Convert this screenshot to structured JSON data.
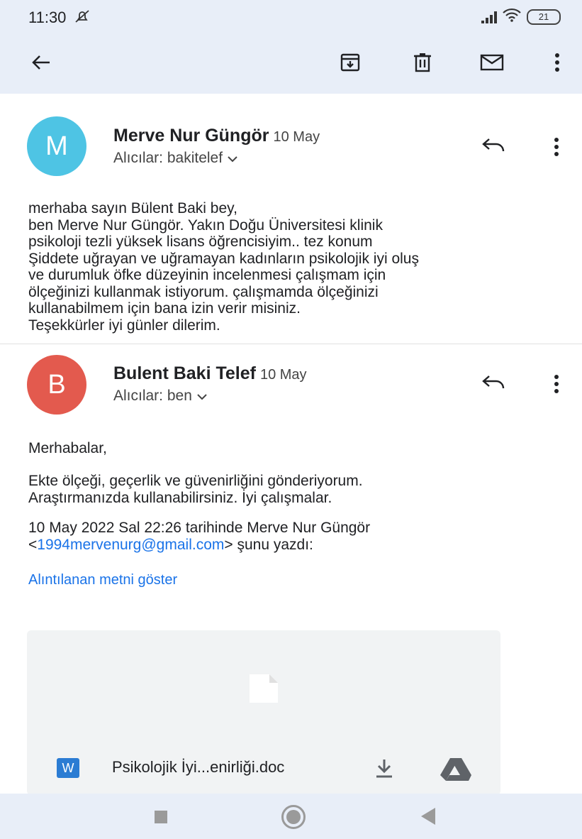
{
  "status_bar": {
    "time": "11:30",
    "battery": "21"
  },
  "message1": {
    "avatar_letter": "M",
    "avatar_color": "#4ec4e4",
    "sender": "Merve Nur Güngör",
    "date": "10 May",
    "recipients": "Alıcılar: bakitelef",
    "body_lines": [
      "merhaba sayın Bülent Baki bey,",
      "ben Merve Nur Güngör. Yakın Doğu Üniversitesi klinik",
      "psikoloji tezli yüksek lisans öğrencisiyim.. tez konum",
      "Şiddete uğrayan ve uğramayan kadınların psikolojik iyi oluş",
      "ve durumluk öfke düzeyinin incelenmesi çalışmam için",
      "ölçeğinizi kullanmak istiyorum. çalışmamda ölçeğinizi",
      "kullanabilmem için bana izin verir misiniz.",
      "Teşekkürler iyi günler dilerim."
    ]
  },
  "message2": {
    "avatar_letter": "B",
    "avatar_color": "#e35a4e",
    "sender": "Bulent Baki Telef",
    "date": "10 May",
    "recipients": "Alıcılar: ben",
    "greeting": "Merhabalar,",
    "body_lines": [
      "Ekte ölçeği, geçerlik ve güvenirliğini gönderiyorum.",
      "Araştırmanızda kullanabilirsiniz. İyi çalışmalar."
    ],
    "quote_header": "10 May 2022 Sal 22:26 tarihinde Merve Nur Güngör",
    "quote_email_prefix": "<",
    "quote_email": "1994mervenurg@gmail.com",
    "quote_email_suffix": "> şunu yazdı:",
    "show_quoted": "Alıntılanan metni göster"
  },
  "attachment": {
    "type_badge": "W",
    "filename": "Psikolojik İyi...enirliği.doc"
  },
  "icons": {
    "back": "arrow-left-icon",
    "archive": "archive-icon",
    "delete": "trash-icon",
    "unread": "mail-icon",
    "more": "more-vert-icon"
  },
  "colors": {
    "accent": "#1a73e8",
    "header_bg": "#e8eef8"
  }
}
